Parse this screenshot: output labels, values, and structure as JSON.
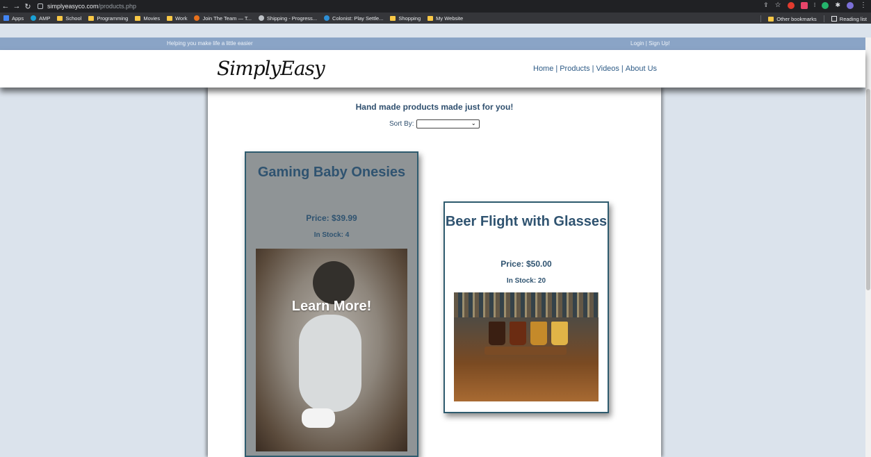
{
  "browser": {
    "url_host": "simplyeasyco.com",
    "url_path": "/products.php",
    "bookmarks": [
      {
        "label": "Apps",
        "type": "apps"
      },
      {
        "label": "AMP",
        "type": "site"
      },
      {
        "label": "School",
        "type": "folder"
      },
      {
        "label": "Programming",
        "type": "folder"
      },
      {
        "label": "Movies",
        "type": "folder"
      },
      {
        "label": "Work",
        "type": "folder"
      },
      {
        "label": "Join The Team — T...",
        "type": "site"
      },
      {
        "label": "Shipping - Progress...",
        "type": "site"
      },
      {
        "label": "Colonist: Play Settle...",
        "type": "site"
      },
      {
        "label": "Shopping",
        "type": "folder"
      },
      {
        "label": "My Website",
        "type": "folder"
      }
    ],
    "other_bookmarks": "Other bookmarks",
    "reading_list": "Reading list"
  },
  "site": {
    "tagline": "Helping you make life a little easier",
    "login": "Login | Sign Up!",
    "logo": "SimplyEasy",
    "nav": [
      "Home",
      "Products",
      "Videos",
      "About Us"
    ],
    "nav_separator": "|"
  },
  "page": {
    "heading": "Hand made products made just for you!",
    "sort_label": "Sort By:",
    "sort_value": ""
  },
  "products": [
    {
      "title": "Gaming Baby Onesies",
      "price": "Price: $39.99",
      "stock": "In Stock: 4",
      "overlay": "Learn More!"
    },
    {
      "title": "Beer Flight with Glasses",
      "price": "Price: $50.00",
      "stock": "In Stock: 20"
    }
  ],
  "colors": {
    "top_strip": "#8aa4c6",
    "page_bg": "#dbe3ec",
    "text_primary": "#2f5370",
    "link": "#2e5b86"
  }
}
